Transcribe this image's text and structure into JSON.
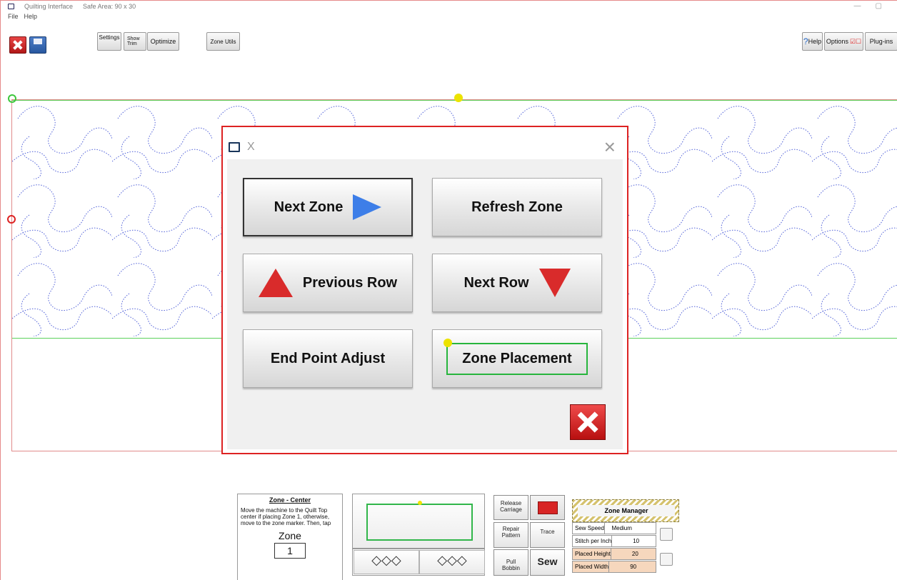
{
  "window": {
    "title": "Quilting Interface",
    "safe_area": "Safe Area: 90 x 30",
    "min": "—",
    "max": "▢"
  },
  "menu": {
    "file": "File",
    "help": "Help"
  },
  "toolbar": {
    "settings": "Settings",
    "show_trim_1": "Show",
    "show_trim_2": "Trim",
    "optimize": "Optimize",
    "zone_utils": "Zone Utils",
    "help": "Help",
    "options": "Options",
    "plugins": "Plug-ins"
  },
  "dialog": {
    "title": "X",
    "close": "×",
    "buttons": {
      "next_zone": "Next Zone",
      "refresh_zone": "Refresh Zone",
      "previous_row": "Previous Row",
      "next_row": "Next Row",
      "end_point_adjust": "End Point Adjust",
      "zone_placement": "Zone Placement"
    }
  },
  "bottom": {
    "info_title": "Zone - Center",
    "info_text": "Move the machine to the Quilt Top center if placing Zone 1, otherwise, move to the zone marker. Then, tap the placement button.",
    "zone_label": "Zone",
    "zone_value": "1",
    "release": "Release",
    "carriage": "Carriage",
    "repair": "Repair",
    "pattern": "Pattern",
    "trace": "Trace",
    "pull": "Pull",
    "bobbin": "Bobbin",
    "sew": "Sew",
    "manager_title": "Zone Manager",
    "rows": [
      {
        "label": "Sew Speed",
        "value": "Medium"
      },
      {
        "label": "Stitch per Inch",
        "value": "10"
      },
      {
        "label": "Placed Height",
        "value": "20"
      },
      {
        "label": "Placed Width",
        "value": "90"
      }
    ]
  },
  "colors": {
    "dialog_border": "#d22222",
    "selection": "#27b53d",
    "marker": "#ece300"
  }
}
